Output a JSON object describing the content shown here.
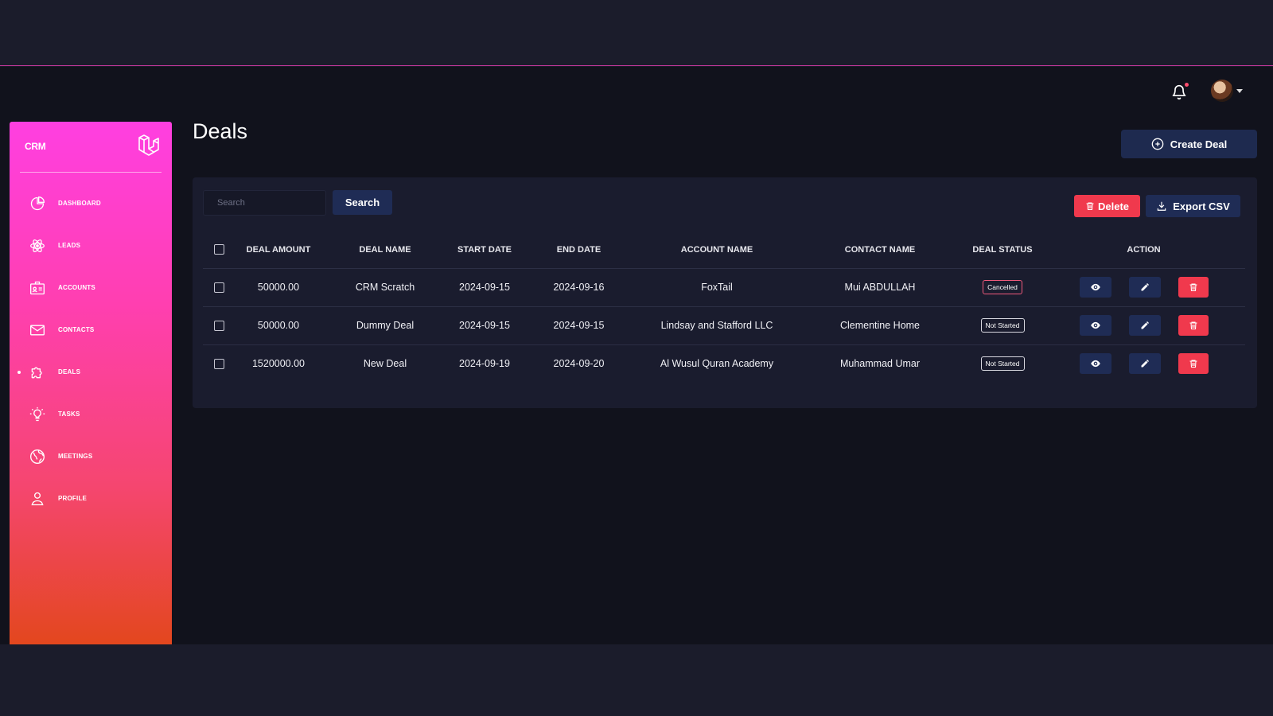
{
  "header": {
    "notifications_icon": "bell-icon",
    "avatar_icon": "user-avatar"
  },
  "sidebar": {
    "brand": "CRM",
    "logo_icon": "laravel-logo-icon",
    "items": [
      {
        "label": "DASHBOARD",
        "icon": "pie-chart-icon"
      },
      {
        "label": "LEADS",
        "icon": "atom-icon"
      },
      {
        "label": "ACCOUNTS",
        "icon": "id-card-icon"
      },
      {
        "label": "CONTACTS",
        "icon": "envelope-icon"
      },
      {
        "label": "DEALS",
        "icon": "puzzle-icon",
        "active": true
      },
      {
        "label": "TASKS",
        "icon": "bulb-icon"
      },
      {
        "label": "MEETINGS",
        "icon": "globe-icon"
      },
      {
        "label": "PROFILE",
        "icon": "user-icon"
      }
    ]
  },
  "main": {
    "title": "Deals",
    "create_label": "Create Deal",
    "search": {
      "placeholder": "Search",
      "button": "Search"
    },
    "delete_label": "Delete",
    "export_label": "Export CSV",
    "table": {
      "headers": [
        "DEAL AMOUNT",
        "DEAL NAME",
        "START DATE",
        "END DATE",
        "ACCOUNT NAME",
        "CONTACT NAME",
        "DEAL STATUS",
        "ACTION"
      ],
      "rows": [
        {
          "amount": "50000.00",
          "name": "CRM Scratch",
          "start": "2024-09-15",
          "end": "2024-09-16",
          "account": "FoxTail",
          "contact": "Mui ABDULLAH",
          "status": "Cancelled"
        },
        {
          "amount": "50000.00",
          "name": "Dummy Deal",
          "start": "2024-09-15",
          "end": "2024-09-15",
          "account": "Lindsay and Stafford LLC",
          "contact": "Clementine Home",
          "status": "Not Started"
        },
        {
          "amount": "1520000.00",
          "name": "New Deal",
          "start": "2024-09-19",
          "end": "2024-09-20",
          "account": "Al Wusul Quran Academy",
          "contact": "Muhammad Umar",
          "status": "Not Started"
        }
      ]
    }
  },
  "colors": {
    "accent_pink": "#ff3fe1",
    "accent_orange": "#e3471e",
    "danger": "#f0394d",
    "primary_dark": "#1f2c55"
  }
}
